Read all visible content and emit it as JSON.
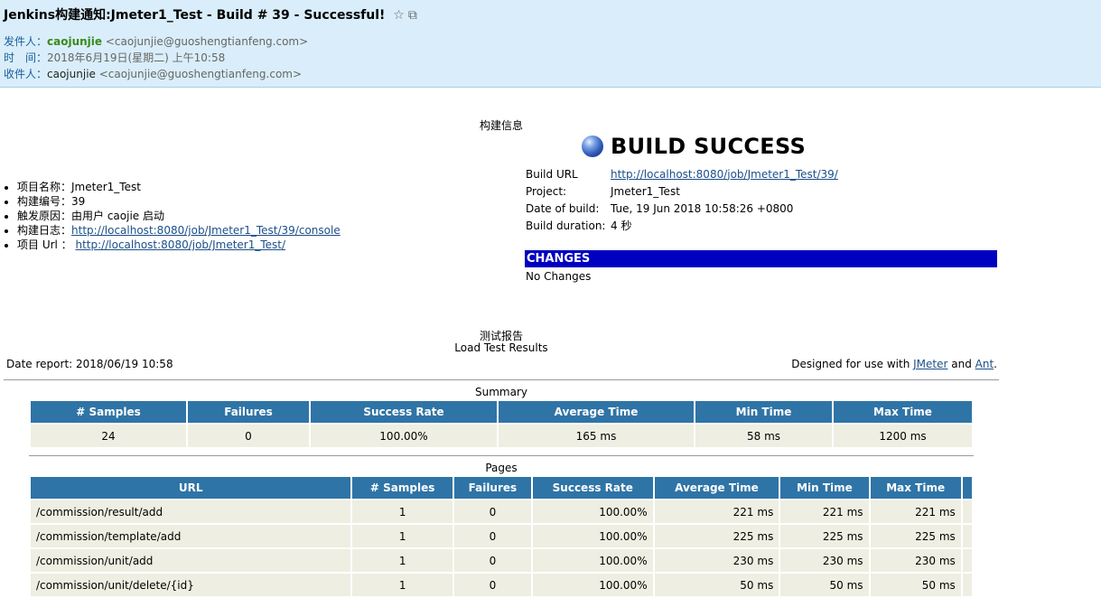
{
  "mail": {
    "subject": "Jenkins构建通知:Jmeter1_Test - Build # 39 - Successful!",
    "icons": [
      "star-icon",
      "popout-icon"
    ],
    "from_label": "发件人：",
    "from_name": "caojunjie",
    "from_addr": "<caojunjie@guoshengtianfeng.com>",
    "time_label": "时　间：",
    "time_value": "2018年6月19日(星期二) 上午10:58",
    "to_label": "收件人：",
    "to_name": "caojunjie",
    "to_addr": "<caojunjie@guoshengtianfeng.com>"
  },
  "build": {
    "section_title": "构建信息",
    "status": "BUILD SUCCESS",
    "list": [
      {
        "label": "项目名称：",
        "value": "Jmeter1_Test"
      },
      {
        "label": "构建编号：",
        "value": "39"
      },
      {
        "label": "触发原因：",
        "value": "由用户 caojie 启动"
      },
      {
        "label": "构建日志：",
        "link": "http://localhost:8080/job/Jmeter1_Test/39/console"
      },
      {
        "label": "项目 Url ： ",
        "link": "http://localhost:8080/job/Jmeter1_Test/"
      }
    ],
    "details": [
      {
        "key": "Build URL",
        "link": "http://localhost:8080/job/Jmeter1_Test/39/"
      },
      {
        "key": "Project:",
        "value": "Jmeter1_Test"
      },
      {
        "key": "Date of build:",
        "value": "Tue, 19 Jun 2018 10:58:26 +0800"
      },
      {
        "key": "Build duration:",
        "value": "4 秒"
      }
    ],
    "changes_title": "CHANGES",
    "changes_text": "No Changes"
  },
  "report": {
    "section_title": "测试报告",
    "subtitle": "Load Test Results",
    "date_label": "Date report: ",
    "date_value": "2018/06/19 10:58",
    "designed_prefix": "Designed for use with ",
    "jmeter_link": "JMeter",
    "and_text": " and ",
    "ant_link": "Ant",
    "period": ".",
    "summary": {
      "title": "Summary",
      "headers": [
        "# Samples",
        "Failures",
        "Success Rate",
        "Average Time",
        "Min Time",
        "Max Time"
      ],
      "row": [
        "24",
        "0",
        "100.00%",
        "165 ms",
        "58 ms",
        "1200 ms"
      ]
    },
    "pages": {
      "title": "Pages",
      "headers": [
        "URL",
        "# Samples",
        "Failures",
        "Success Rate",
        "Average Time",
        "Min Time",
        "Max Time"
      ],
      "rows": [
        [
          "/commission/result/add",
          "1",
          "0",
          "100.00%",
          "221 ms",
          "221 ms",
          "221 ms"
        ],
        [
          "/commission/template/add",
          "1",
          "0",
          "100.00%",
          "225 ms",
          "225 ms",
          "225 ms"
        ],
        [
          "/commission/unit/add",
          "1",
          "0",
          "100.00%",
          "230 ms",
          "230 ms",
          "230 ms"
        ],
        [
          "/commission/unit/delete/{id}",
          "1",
          "0",
          "100.00%",
          "50 ms",
          "50 ms",
          "50 ms"
        ]
      ]
    }
  }
}
